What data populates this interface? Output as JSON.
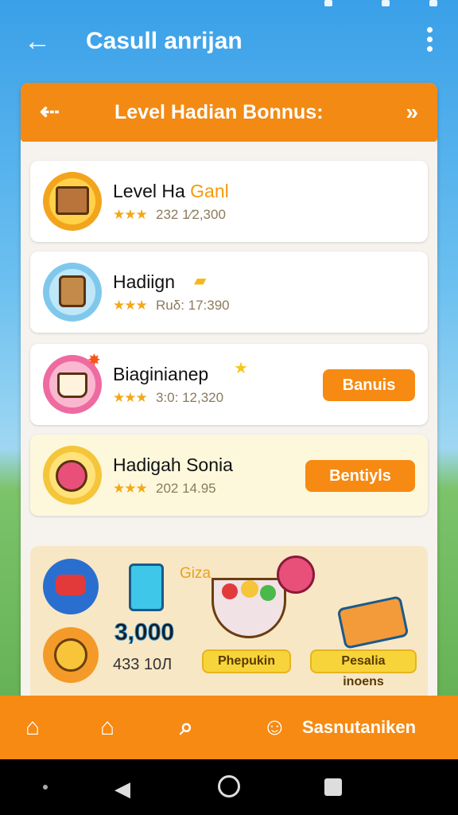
{
  "app": {
    "title": "Casull anrijan"
  },
  "panel": {
    "title": "Level Hadian Bonnus:"
  },
  "cards": [
    {
      "name": "Level Ha ",
      "tag": "Ganl",
      "stars": "★★★",
      "meta": "232  1⁄2,300",
      "button": ""
    },
    {
      "name": "Hadiign",
      "tag": "",
      "stars": "★★★",
      "meta": "Ruδ:  17:390",
      "button": ""
    },
    {
      "name": "Biaginianep",
      "tag": "",
      "stars": "★★★",
      "meta": "3:0:  12,320",
      "button": "Banuis"
    },
    {
      "name": "Hadigah Sonia",
      "tag": "",
      "stars": "★★★",
      "meta": "202  14.95",
      "button": "Bentiyls"
    }
  ],
  "rewards": {
    "label": "Giza",
    "big_value": "3,000",
    "small_value": "433  10Л",
    "pill_left": "Phepukin",
    "pill_right": "Pesalia inoens"
  },
  "nav": {
    "label": "Sasnutaniken"
  },
  "icons": [
    "back-arrow-icon",
    "more-icon",
    "crate-icon",
    "character-icon",
    "cup-icon",
    "donut-icon",
    "home-icon",
    "search-icon",
    "user-icon"
  ],
  "colors": {
    "accent": "#f68a12",
    "sky": "#3aa0e8"
  }
}
